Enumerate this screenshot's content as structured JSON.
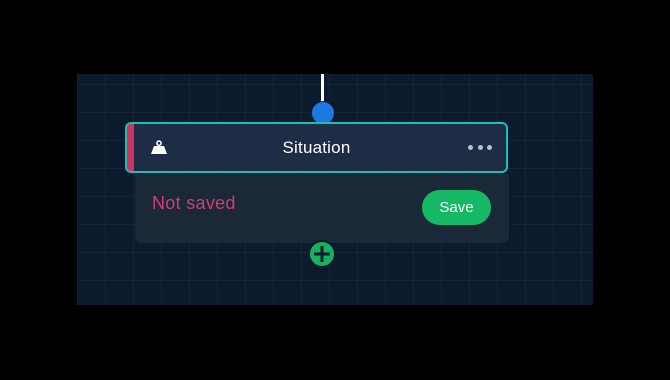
{
  "node": {
    "title": "Situation",
    "icon": "weight-scale-icon",
    "menu_icon": "more-horizontal-icon",
    "status": "Not saved",
    "save_label": "Save"
  },
  "colors": {
    "canvas_background": "#0c1a2e",
    "node_border": "#1ebfae",
    "accent": "#d23364",
    "status_text": "#d23c74",
    "save_button": "#14b865",
    "input_port": "#1f78e0",
    "add_port": "#16b25f"
  }
}
